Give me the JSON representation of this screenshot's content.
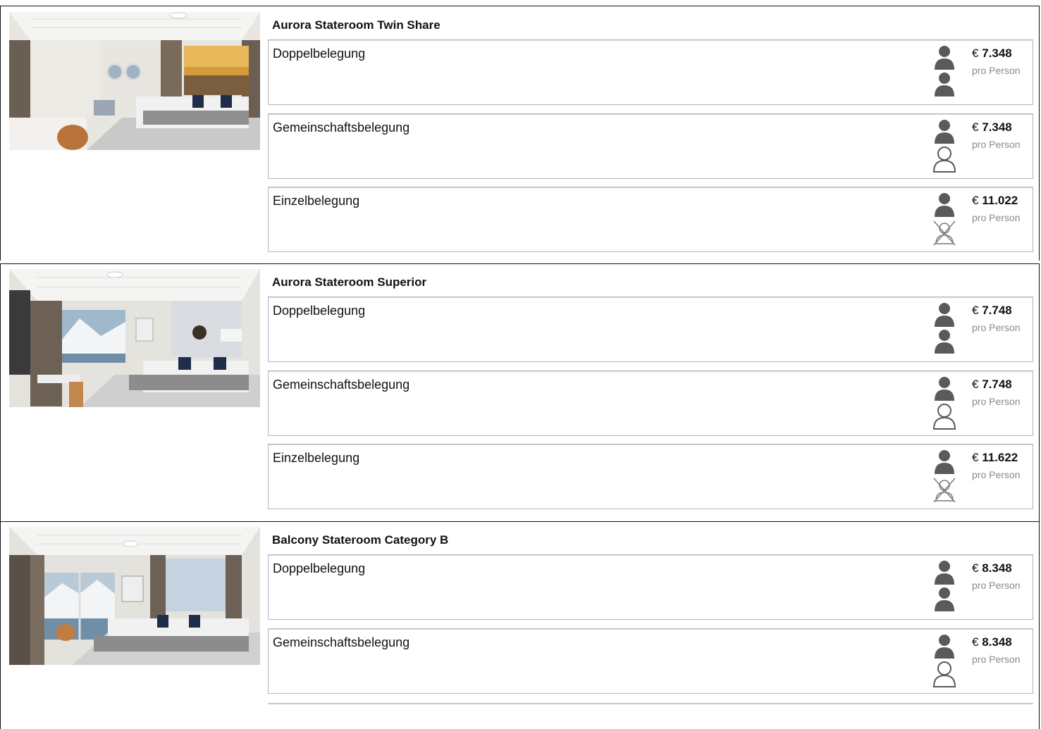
{
  "cabins": [
    {
      "title": "Aurora Stateroom Twin Share",
      "options": [
        {
          "label": "Doppelbelegung",
          "currency": "€",
          "price": "7.348",
          "per": "pro Person",
          "icons": [
            "person-filled-icon",
            "person-filled-icon"
          ]
        },
        {
          "label": "Gemeinschaftsbelegung",
          "currency": "€",
          "price": "7.348",
          "per": "pro Person",
          "icons": [
            "person-filled-icon",
            "person-outline-icon"
          ]
        },
        {
          "label": "Einzelbelegung",
          "currency": "€",
          "price": "11.022",
          "per": "pro Person",
          "icons": [
            "person-filled-icon",
            "person-crossed-icon"
          ]
        }
      ]
    },
    {
      "title": "Aurora Stateroom Superior",
      "options": [
        {
          "label": "Doppelbelegung",
          "currency": "€",
          "price": "7.748",
          "per": "pro Person",
          "icons": [
            "person-filled-icon",
            "person-filled-icon"
          ]
        },
        {
          "label": "Gemeinschaftsbelegung",
          "currency": "€",
          "price": "7.748",
          "per": "pro Person",
          "icons": [
            "person-filled-icon",
            "person-outline-icon"
          ]
        },
        {
          "label": "Einzelbelegung",
          "currency": "€",
          "price": "11.622",
          "per": "pro Person",
          "icons": [
            "person-filled-icon",
            "person-crossed-icon"
          ]
        }
      ]
    },
    {
      "title": "Balcony Stateroom Category B",
      "options": [
        {
          "label": "Doppelbelegung",
          "currency": "€",
          "price": "8.348",
          "per": "pro Person",
          "icons": [
            "person-filled-icon",
            "person-filled-icon"
          ]
        },
        {
          "label": "Gemeinschaftsbelegung",
          "currency": "€",
          "price": "8.348",
          "per": "pro Person",
          "icons": [
            "person-filled-icon",
            "person-outline-icon"
          ]
        }
      ]
    }
  ],
  "colors": {
    "icon_fill": "#5a5a5a",
    "border": "#b5b5b5",
    "section_border": "#111111",
    "muted_text": "#8a8a8a"
  }
}
